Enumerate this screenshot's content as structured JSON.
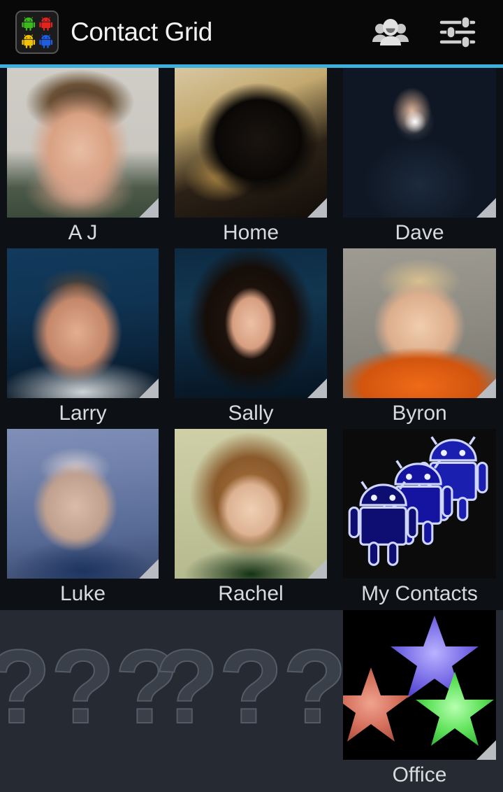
{
  "app": {
    "title": "Contact Grid",
    "icon_name": "contact-grid-app-icon",
    "icon_colors": [
      "#3bb91f",
      "#e0241f",
      "#f2c400",
      "#1f5ce0"
    ],
    "accent_color": "#3fb0dd",
    "background_color": "#0d1014",
    "header_background": "#080808",
    "label_color": "#d8dadd"
  },
  "header": {
    "actions": [
      {
        "name": "groups-icon",
        "label": "Groups"
      },
      {
        "name": "settings-sliders-icon",
        "label": "Settings"
      }
    ]
  },
  "grid": {
    "columns": 3,
    "rows": [
      {
        "cells": [
          {
            "label": "A J",
            "photo": "p-aj",
            "has_fold": true,
            "type": "contact"
          },
          {
            "label": "Home",
            "photo": "p-home",
            "has_fold": true,
            "type": "contact"
          },
          {
            "label": "Dave",
            "photo": "p-dave",
            "has_fold": true,
            "type": "contact"
          }
        ]
      },
      {
        "cells": [
          {
            "label": "Larry",
            "photo": "p-larry",
            "has_fold": true,
            "type": "contact"
          },
          {
            "label": "Sally",
            "photo": "p-sally",
            "has_fold": true,
            "type": "contact"
          },
          {
            "label": "Byron",
            "photo": "p-byron",
            "has_fold": true,
            "type": "contact"
          }
        ]
      },
      {
        "cells": [
          {
            "label": "Luke",
            "photo": "p-luke",
            "has_fold": true,
            "type": "contact"
          },
          {
            "label": "Rachel",
            "photo": "p-rachel",
            "has_fold": true,
            "type": "contact"
          },
          {
            "label": "My Contacts",
            "photo": "p-mycontacts",
            "has_fold": false,
            "type": "group"
          }
        ]
      },
      {
        "background": "#262b33",
        "cells": [
          {
            "label": "",
            "photo": "placeholder",
            "has_fold": false,
            "type": "placeholder",
            "placeholder_text": "???"
          },
          {
            "label": "",
            "photo": "placeholder",
            "has_fold": false,
            "type": "placeholder",
            "placeholder_text": "???"
          },
          {
            "label": "Office",
            "photo": "p-office",
            "has_fold": true,
            "type": "group"
          }
        ]
      }
    ]
  }
}
